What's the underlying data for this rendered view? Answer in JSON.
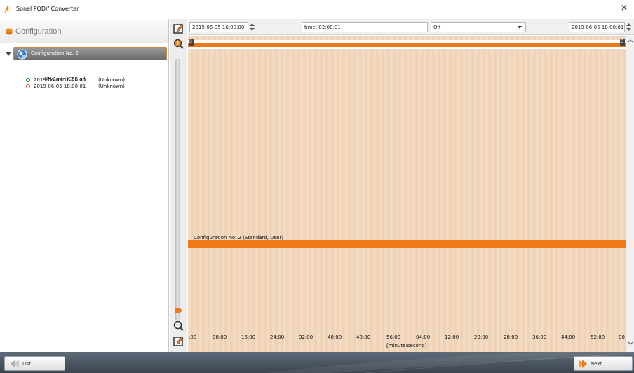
{
  "window": {
    "title": "Sonel PQDif Converter",
    "close_glyph": "×"
  },
  "left": {
    "header": "Configuration",
    "tree": {
      "node_label": "Configuration No. 2",
      "sub_label": "YN 1min IEEE  all",
      "rows": [
        {
          "datetime": "2019-06-05 16:00:00",
          "status": "(Unknown)",
          "dot_color": "#2a9a2a"
        },
        {
          "datetime": "2019-06-05 18:00:01",
          "status": "(Unknown)",
          "dot_color": "#d63a2a"
        }
      ]
    }
  },
  "controls": {
    "start_datetime": "2019-06-05 16:00:00",
    "time_display": "time: 02:00:01",
    "mode_select": "Off",
    "end_datetime": "2019-06-05 18:00:01"
  },
  "timeline": {
    "range_start_marker": "S",
    "range_end_marker": "E",
    "config_bar_label": "Configuration No. 2 (Standard, User)",
    "axis_ticks": [
      ":00",
      "08:00",
      "16:00",
      "24:00",
      "32:00",
      "40:00",
      "48:00",
      "56:00",
      "04:00",
      "12:00",
      "20:00",
      "28:00",
      "36:00",
      "44:00",
      "52:00",
      "00"
    ],
    "axis_unit": "[minute:second]"
  },
  "footer": {
    "list_button": "List",
    "next_button": "Next"
  },
  "colors": {
    "accent_orange": "#f07a1a",
    "timeline_bg": "#f0d2b6",
    "footer_bg": "#4a5360"
  }
}
